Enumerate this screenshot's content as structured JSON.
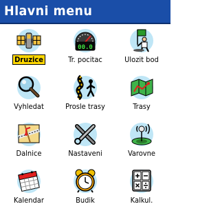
{
  "window": {
    "title": "Hlavni menu"
  },
  "menu": {
    "items": [
      {
        "label": "Druzice",
        "icon": "satellite-icon",
        "selected": true
      },
      {
        "label": "Tr. pocitac",
        "icon": "trip-computer-icon",
        "selected": false
      },
      {
        "label": "Ulozit bod",
        "icon": "save-waypoint-icon",
        "selected": false
      },
      {
        "label": "Vyhledat",
        "icon": "magnifier-icon",
        "selected": false
      },
      {
        "label": "Prosle trasy",
        "icon": "tracks-icon",
        "selected": false
      },
      {
        "label": "Trasy",
        "icon": "routes-icon",
        "selected": false
      },
      {
        "label": "Dalnice",
        "icon": "highway-icon",
        "selected": false
      },
      {
        "label": "Nastaveni",
        "icon": "tools-icon",
        "selected": false
      },
      {
        "label": "Varovne",
        "icon": "proximity-alarm-icon",
        "selected": false
      },
      {
        "label": "Kalendar",
        "icon": "calendar-icon",
        "selected": false
      },
      {
        "label": "Budik",
        "icon": "alarm-clock-icon",
        "selected": false
      },
      {
        "label": "Kalkul.",
        "icon": "calculator-icon",
        "selected": false
      }
    ]
  },
  "colors": {
    "title_bar": "#1a4ea8",
    "selection": "#ffd800",
    "icon_disc": "#bfe6f6"
  }
}
